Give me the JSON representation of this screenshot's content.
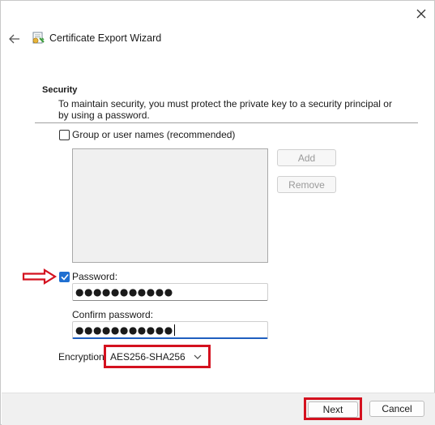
{
  "window": {
    "title": "Certificate Export Wizard",
    "icons": {
      "close": "close-icon",
      "back": "back-arrow-icon",
      "app": "certificate-icon"
    }
  },
  "section": {
    "title": "Security",
    "description": "To maintain security, you must protect the private key to a security principal or by using a password."
  },
  "group": {
    "checkbox_label": "Group or user names (recommended)",
    "checked": false,
    "add_label": "Add",
    "remove_label": "Remove"
  },
  "password": {
    "checkbox_label": "Password:",
    "checked": true,
    "value": "●●●●●●●●●●●",
    "confirm_label": "Confirm password:",
    "confirm_value": "●●●●●●●●●●●"
  },
  "encryption": {
    "label": "Encryption:",
    "selected": "AES256-SHA256"
  },
  "footer": {
    "next_label": "Next",
    "cancel_label": "Cancel"
  },
  "colors": {
    "highlight": "#d4111f",
    "accent": "#1f6fd1"
  }
}
